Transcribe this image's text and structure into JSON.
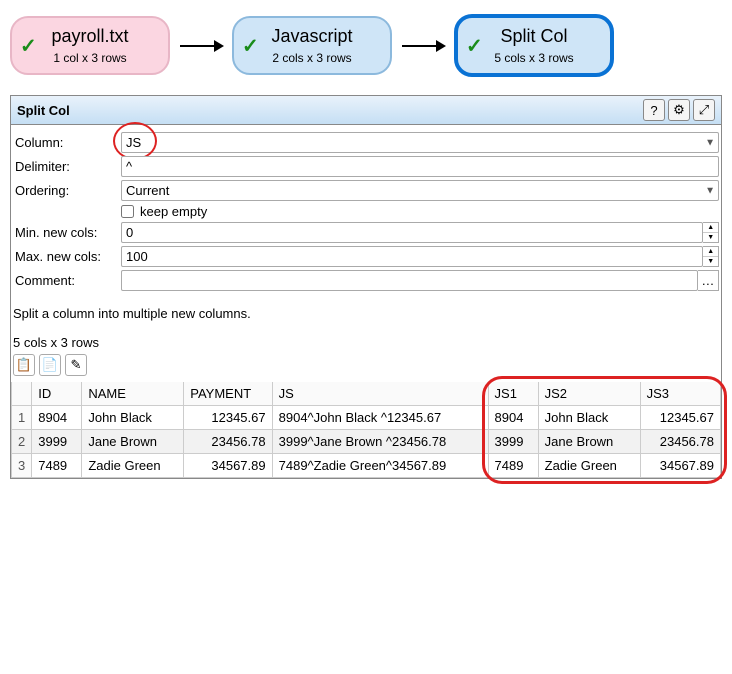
{
  "flow": {
    "nodes": [
      {
        "title": "payroll.txt",
        "subtitle": "1 col x 3 rows",
        "style": "pink"
      },
      {
        "title": "Javascript",
        "subtitle": "2 cols x 3 rows",
        "style": "blue"
      },
      {
        "title": "Split Col",
        "subtitle": "5 cols x 3 rows",
        "style": "blue-selected"
      }
    ]
  },
  "panel": {
    "title": "Split Col",
    "form": {
      "column_label": "Column:",
      "column_value": "JS",
      "delimiter_label": "Delimiter:",
      "delimiter_value": "^",
      "ordering_label": "Ordering:",
      "ordering_value": "Current",
      "keep_empty_label": "keep empty",
      "min_cols_label": "Min. new cols:",
      "min_cols_value": "0",
      "max_cols_label": "Max. new cols:",
      "max_cols_value": "100",
      "comment_label": "Comment:",
      "comment_value": ""
    },
    "description": "Split a column into multiple new columns."
  },
  "table": {
    "summary": "5 cols x 3 rows",
    "headers": [
      "ID",
      "NAME",
      "PAYMENT",
      "JS",
      "JS1",
      "JS2",
      "JS3"
    ],
    "rows": [
      {
        "n": "1",
        "ID": "8904",
        "NAME": "John Black",
        "PAYMENT": "12345.67",
        "JS": "8904^John Black ^12345.67",
        "JS1": "8904",
        "JS2": "John Black",
        "JS3": "12345.67"
      },
      {
        "n": "2",
        "ID": "3999",
        "NAME": "Jane Brown",
        "PAYMENT": "23456.78",
        "JS": "3999^Jane Brown ^23456.78",
        "JS1": "3999",
        "JS2": "Jane Brown",
        "JS3": "23456.78"
      },
      {
        "n": "3",
        "ID": "7489",
        "NAME": "Zadie Green",
        "PAYMENT": "34567.89",
        "JS": "7489^Zadie Green^34567.89",
        "JS1": "7489",
        "JS2": "Zadie Green",
        "JS3": "34567.89"
      }
    ]
  }
}
